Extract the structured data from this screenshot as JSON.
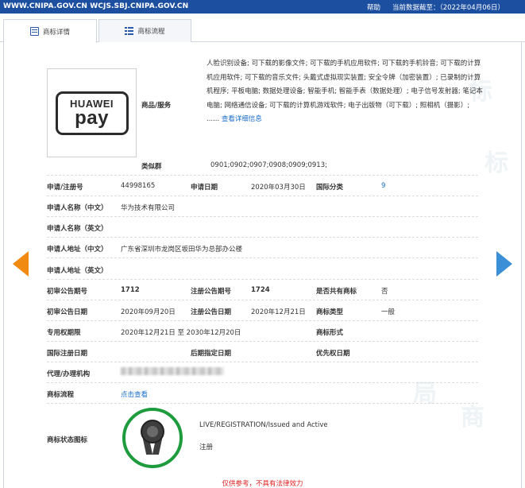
{
  "topbar": {
    "domains": "WWW.CNIPA.GOV.CN  WCJS.SBJ.CNIPA.GOV.CN",
    "help": "帮助",
    "as_of": "当前数据截至：（2022年04月06日）"
  },
  "tabs": [
    {
      "label": "商标详情",
      "icon": "document-icon"
    },
    {
      "label": "商标流程",
      "icon": "list-icon"
    }
  ],
  "logo": {
    "line1": "HUAWEI",
    "line2": "pay"
  },
  "goods": {
    "label": "商品/服务",
    "text": "人脸识别设备; 可下载的影像文件; 可下载的手机应用软件; 可下载的手机铃音; 可下载的计算机应用软件; 可下载的音乐文件; 头戴式虚拟现实装置; 安全令牌（加密装置）; 已录制的计算机程序; 平板电脑; 数据处理设备; 智能手机; 智能手表（数据处理）; 电子信号发射器; 笔记本电脑; 网络通信设备; 可下载的计算机游戏软件; 电子出版物（可下载）; 照相机（摄影）; ......",
    "more_link": "查看详细信息"
  },
  "similar_group": {
    "label": "类似群",
    "value": "0901;0902;0907;0908;0909;0913;"
  },
  "fields": {
    "reg_no_label": "申请/注册号",
    "reg_no": "44998165",
    "app_date_label": "申请日期",
    "app_date": "2020年03月30日",
    "intl_class_label": "国际分类",
    "intl_class": "9",
    "applicant_cn_label": "申请人名称（中文）",
    "applicant_cn": "华为技术有限公司",
    "applicant_en_label": "申请人名称（英文）",
    "address_cn_label": "申请人地址（中文）",
    "address_cn": "广东省深圳市龙岗区坂田华为总部办公楼",
    "address_en_label": "申请人地址（英文）",
    "prelim_no_label": "初审公告期号",
    "prelim_no": "1712",
    "reg_pub_no_label": "注册公告期号",
    "reg_pub_no": "1724",
    "shared_label": "是否共有商标",
    "shared": "否",
    "prelim_date_label": "初审公告日期",
    "prelim_date": "2020年09月20日",
    "reg_pub_date_label": "注册公告日期",
    "reg_pub_date": "2020年12月21日",
    "type_label": "商标类型",
    "type": "一般",
    "period_label": "专用权期限",
    "period": "2020年12月21日 至 2030年12月20日",
    "form_label": "商标形式",
    "intl_reg_date_label": "国际注册日期",
    "later_date_label": "后期指定日期",
    "priority_date_label": "优先权日期",
    "agent_label": "代理/办理机构",
    "flow_label": "商标流程",
    "flow_link": "点击查看",
    "status_icon_label": "商标状态图标"
  },
  "status": {
    "en": "LIVE/REGISTRATION/Issued and Active",
    "cn": "注册",
    "ring_color": "#1e9b3c"
  },
  "footer_note": "仅供参考，不具有法律效力",
  "colors": {
    "topbar": "#1c4fa0",
    "link": "#1a6fc9",
    "prev_arrow": "#f08a10",
    "next_arrow": "#3a8fd6",
    "note": "#e02020"
  }
}
